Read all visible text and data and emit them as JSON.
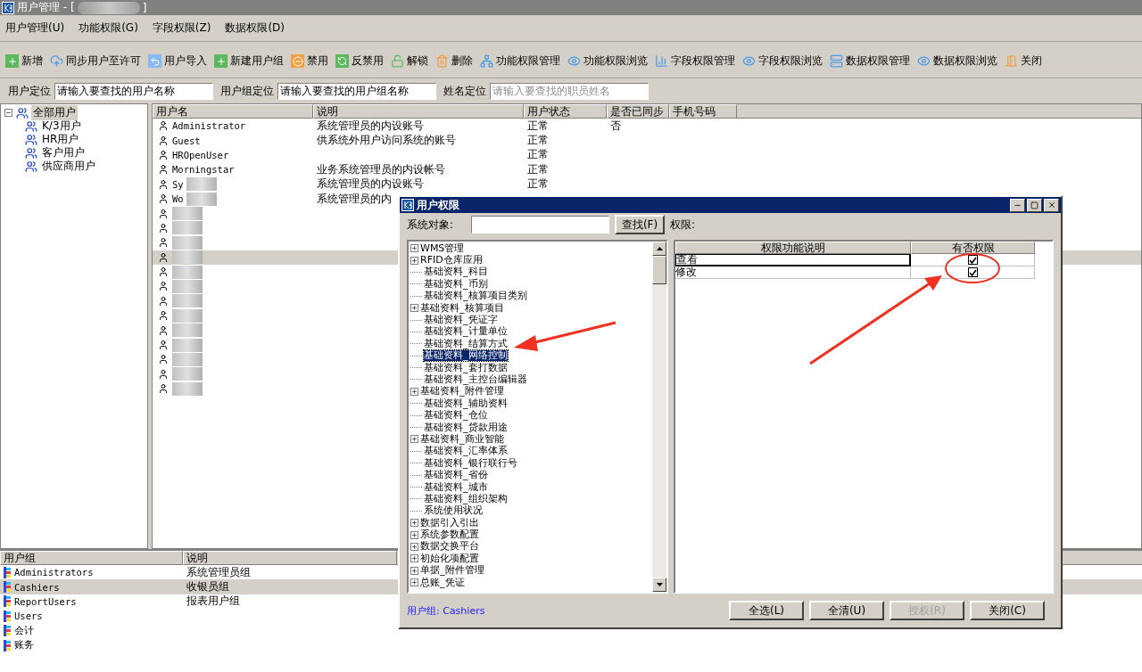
{
  "window": {
    "title": "用户管理 - [",
    "title_end": "]"
  },
  "menu": [
    "用户管理(U)",
    "功能权限(G)",
    "字段权限(Z)",
    "数据权限(D)"
  ],
  "toolbar": [
    "新增",
    "同步用户至许可",
    "用户导入",
    "新建用户组",
    "禁用",
    "反禁用",
    "解锁",
    "删除",
    "功能权限管理",
    "功能权限浏览",
    "字段权限管理",
    "字段权限浏览",
    "数据权限管理",
    "数据权限浏览",
    "关闭"
  ],
  "locators": [
    {
      "label": "用户定位",
      "value": "请输入要查找的用户名称"
    },
    {
      "label": "用户组定位",
      "value": "请输入要查找的用户组名称"
    },
    {
      "label": "姓名定位",
      "placeholder": "请输入要查找的职员姓名"
    }
  ],
  "user_tree": {
    "label": "全部用户",
    "selected": true,
    "expanded": true,
    "children": [
      {
        "label": "K/3用户",
        "selected": false
      },
      {
        "label": "HR用户",
        "selected": false
      },
      {
        "label": "客户用户",
        "selected": false
      },
      {
        "label": "供应商用户",
        "selected": false
      }
    ]
  },
  "users": {
    "columns": [
      "用户名",
      "说明",
      "用户状态",
      "是否已同步",
      "手机号码"
    ],
    "rows": [
      {
        "name": "Administrator",
        "description": "系统管理员的内设账号",
        "status": "正常",
        "synced": "否",
        "masked": false,
        "selected": false
      },
      {
        "name": "Guest",
        "description": "供系统外用户访问系统的账号",
        "status": "正常",
        "masked": false,
        "selected": false
      },
      {
        "name": "HROpenUser",
        "status": "正常",
        "masked": false,
        "selected": false
      },
      {
        "name": "Morningstar",
        "description": "业务系统管理员的内设帐号",
        "status": "正常",
        "masked": false,
        "selected": false
      },
      {
        "name": "Sy",
        "description": "系统管理员的内设账号",
        "status": "正常",
        "masked": true,
        "selected": false
      },
      {
        "name": "Wo",
        "description": "系统管理员的内",
        "masked": true,
        "selected": false
      },
      {
        "masked": true,
        "selected": false
      },
      {
        "masked": true,
        "selected": false
      },
      {
        "masked": true,
        "selected": false
      },
      {
        "masked": true,
        "selected": true
      },
      {
        "masked": true,
        "selected": false
      },
      {
        "masked": true,
        "selected": false
      },
      {
        "masked": true,
        "selected": false
      },
      {
        "masked": true,
        "selected": false
      },
      {
        "masked": true,
        "selected": false
      },
      {
        "masked": true,
        "selected": false
      },
      {
        "masked": true,
        "selected": false
      },
      {
        "masked": true,
        "selected": false
      },
      {
        "masked": true,
        "selected": false
      }
    ]
  },
  "groups": {
    "columns": [
      "用户组",
      "说明"
    ],
    "rows": [
      {
        "name": "Administrators",
        "description": "系统管理员组",
        "selected": false
      },
      {
        "name": "Cashiers",
        "description": "收银员组",
        "selected": true
      },
      {
        "name": "ReportUsers",
        "description": "报表用户组",
        "selected": false
      },
      {
        "name": "Users",
        "selected": false
      },
      {
        "name": "会计",
        "selected": false
      },
      {
        "name": "账务",
        "selected": false
      }
    ]
  },
  "dialog": {
    "title": "用户权限",
    "object_label": "系统对象:",
    "find_button": "查找(F)",
    "rights_label": "权限:",
    "tree": [
      {
        "label": "WMS管理",
        "expandable": true,
        "selected": false
      },
      {
        "label": "RFID仓库应用",
        "expandable": true,
        "selected": false
      },
      {
        "label": "基础资料_科目",
        "expandable": false,
        "selected": false
      },
      {
        "label": "基础资料_币别",
        "expandable": false,
        "selected": false
      },
      {
        "label": "基础资料_核算项目类别",
        "expandable": false,
        "selected": false
      },
      {
        "label": "基础资料_核算项目",
        "expandable": true,
        "selected": false
      },
      {
        "label": "基础资料_凭证字",
        "expandable": false,
        "selected": false
      },
      {
        "label": "基础资料_计量单位",
        "expandable": false,
        "selected": false
      },
      {
        "label": "基础资料_结算方式",
        "expandable": false,
        "selected": false
      },
      {
        "label": "基础资料_网络控制",
        "expandable": false,
        "selected": true
      },
      {
        "label": "基础资料_套打数据",
        "expandable": false,
        "selected": false
      },
      {
        "label": "基础资料_主控台编辑器",
        "expandable": false,
        "selected": false
      },
      {
        "label": "基础资料_附件管理",
        "expandable": true,
        "selected": false
      },
      {
        "label": "基础资料_辅助资料",
        "expandable": false,
        "selected": false
      },
      {
        "label": "基础资料_仓位",
        "expandable": false,
        "selected": false
      },
      {
        "label": "基础资料_贷款用途",
        "expandable": false,
        "selected": false
      },
      {
        "label": "基础资料_商业智能",
        "expandable": true,
        "selected": false
      },
      {
        "label": "基础资料_汇率体系",
        "expandable": false,
        "selected": false
      },
      {
        "label": "基础资料_银行联行号",
        "expandable": false,
        "selected": false
      },
      {
        "label": "基础资料_省份",
        "expandable": false,
        "selected": false
      },
      {
        "label": "基础资料_城市",
        "expandable": false,
        "selected": false
      },
      {
        "label": "基础资料_组织架构",
        "expandable": false,
        "selected": false
      },
      {
        "label": "系统使用状况",
        "expandable": false,
        "selected": false
      },
      {
        "label": "数据引入引出",
        "expandable": true,
        "selected": false
      },
      {
        "label": "系统参数配置",
        "expandable": true,
        "selected": false
      },
      {
        "label": "数据交换平台",
        "expandable": true,
        "selected": false
      },
      {
        "label": "初始化项配置",
        "expandable": true,
        "selected": false
      },
      {
        "label": "单据_附件管理",
        "expandable": true,
        "selected": false
      },
      {
        "label": "总账_凭证",
        "expandable": true,
        "selected": false
      }
    ],
    "rights": {
      "columns": [
        "权限功能说明",
        "有否权限"
      ],
      "rows": [
        {
          "label": "查看",
          "checked": true,
          "selected": true
        },
        {
          "label": "修改",
          "checked": true,
          "selected": false
        }
      ]
    },
    "group_label": "用户组: Cashiers",
    "buttons": [
      {
        "label": "全选(L)",
        "disabled": false
      },
      {
        "label": "全清(U)",
        "disabled": false
      },
      {
        "label": "授权(R)",
        "disabled": true
      },
      {
        "label": "关闭(C)",
        "disabled": false
      }
    ]
  }
}
